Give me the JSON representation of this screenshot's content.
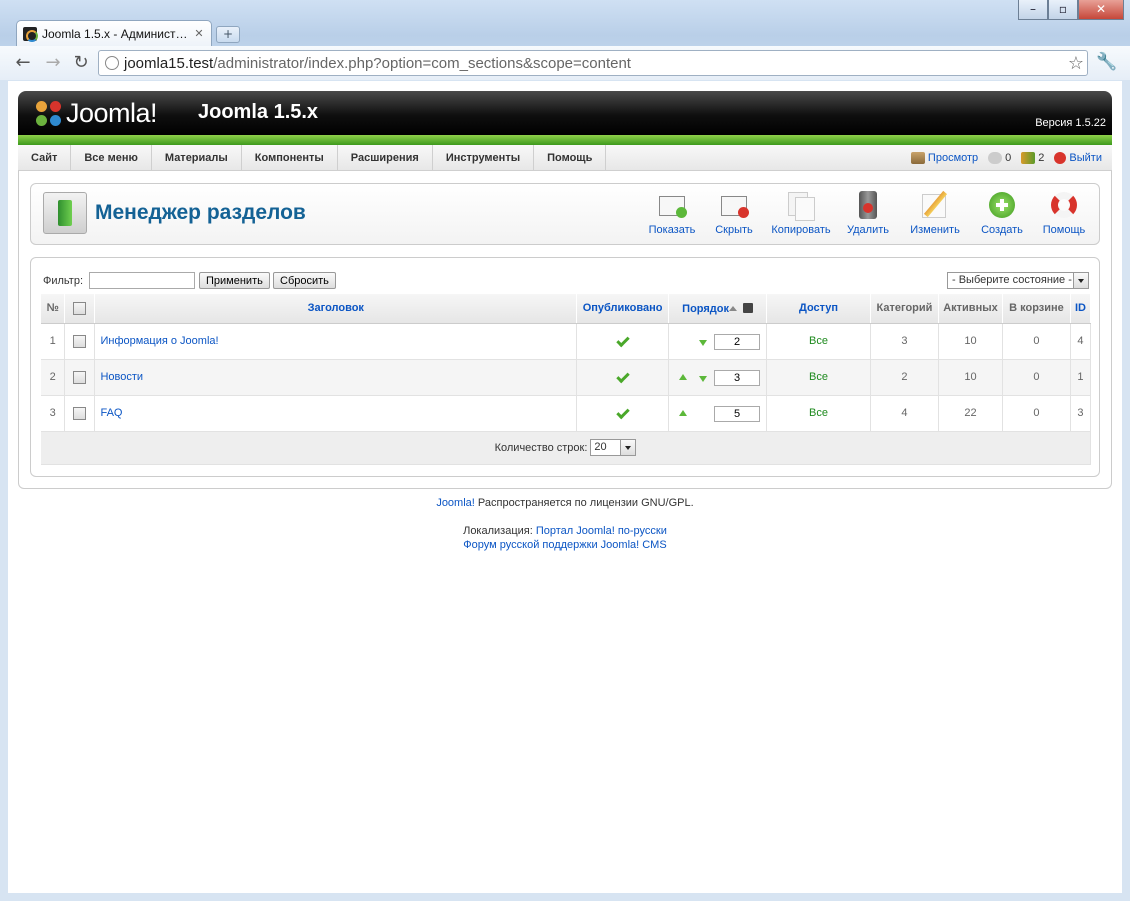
{
  "browser": {
    "tab_title": "Joomla 1.5.x - Админист…",
    "url_host": "joomla15.test",
    "url_rest": "/administrator/index.php?option=com_sections&scope=content"
  },
  "header": {
    "logo_text": "Joomla!",
    "site_title": "Joomla 1.5.x",
    "version": "Версия 1.5.22"
  },
  "menu": {
    "items": [
      "Сайт",
      "Все меню",
      "Материалы",
      "Компоненты",
      "Расширения",
      "Инструменты",
      "Помощь"
    ],
    "preview": "Просмотр",
    "messages_count": "0",
    "users_count": "2",
    "logout": "Выйти"
  },
  "toolbar": {
    "title": "Менеджер разделов",
    "buttons": [
      "Показать",
      "Скрыть",
      "Копировать",
      "Удалить",
      "Изменить",
      "Создать",
      "Помощь"
    ]
  },
  "filter": {
    "label": "Фильтр:",
    "value": "",
    "apply": "Применить",
    "reset": "Сбросить",
    "state_select": "- Выберите состояние -"
  },
  "table": {
    "headers": {
      "num": "№",
      "title": "Заголовок",
      "published": "Опубликовано",
      "order": "Порядок",
      "access": "Доступ",
      "categories": "Категорий",
      "active": "Активных",
      "trash": "В корзине",
      "id": "ID"
    },
    "rows": [
      {
        "num": "1",
        "title": "Информация о Joomla!",
        "order": "2",
        "access": "Все",
        "categories": "3",
        "active": "10",
        "trash": "0",
        "id": "4"
      },
      {
        "num": "2",
        "title": "Новости",
        "order": "3",
        "access": "Все",
        "categories": "2",
        "active": "10",
        "trash": "0",
        "id": "1"
      },
      {
        "num": "3",
        "title": "FAQ",
        "order": "5",
        "access": "Все",
        "categories": "4",
        "active": "22",
        "trash": "0",
        "id": "3"
      }
    ],
    "limit_label": "Количество строк:",
    "limit_value": "20"
  },
  "footer": {
    "joomla_link": "Joomla!",
    "license_text": " Распространяется по лицензии GNU/GPL.",
    "loc_label": "Локализация: ",
    "loc_link": "Портал Joomla! по-русски",
    "forum_link": "Форум русской поддержки Joomla! CMS"
  }
}
